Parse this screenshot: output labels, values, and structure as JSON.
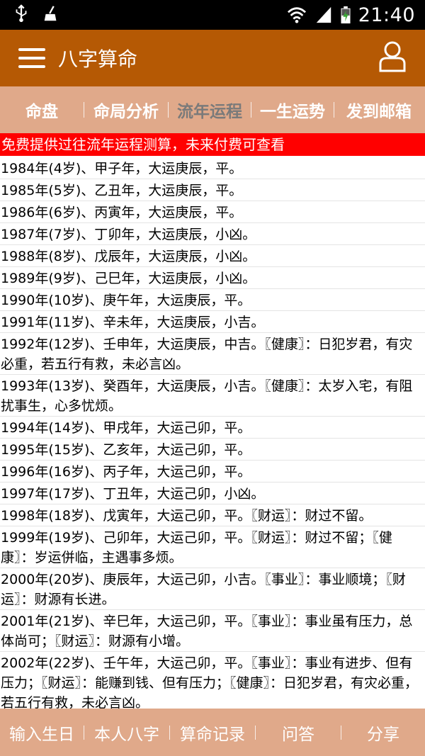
{
  "status_bar": {
    "time": "21:40",
    "icons": [
      "usb-icon",
      "cleaner-icon",
      "wifi-icon",
      "signal-icon",
      "battery-charging-icon"
    ]
  },
  "app_bar": {
    "title": "八字算命",
    "menu_icon": "hamburger-menu-icon",
    "user_icon": "user-profile-icon"
  },
  "tabs": [
    {
      "label": "命盘"
    },
    {
      "label": "命局分析"
    },
    {
      "label": "流年运程"
    },
    {
      "label": "一生运势"
    },
    {
      "label": "发到邮箱"
    }
  ],
  "active_tab": "流年运程",
  "notice": "免费提供过往流年运程测算，未来付费可查看",
  "entries": [
    "1984年(4岁)、甲子年，大运庚辰，平。",
    "1985年(5岁)、乙丑年，大运庚辰，平。",
    "1986年(6岁)、丙寅年，大运庚辰，平。",
    "1987年(7岁)、丁卯年，大运庚辰，小凶。",
    "1988年(8岁)、戊辰年，大运庚辰，小凶。",
    "1989年(9岁)、己巳年，大运庚辰，小凶。",
    "1990年(10岁)、庚午年，大运庚辰，平。",
    "1991年(11岁)、辛未年，大运庚辰，小吉。",
    "1992年(12岁)、壬申年，大运庚辰，中吉。〖健康〗：日犯岁君，有灾必重，若五行有救，未必言凶。",
    "1993年(13岁)、癸酉年，大运庚辰，小吉。〖健康〗：太岁入宅，有阻扰事生，心多忧烦。",
    "1994年(14岁)、甲戌年，大运己卯，平。",
    "1995年(15岁)、乙亥年，大运己卯，平。",
    "1996年(16岁)、丙子年，大运己卯，平。",
    "1997年(17岁)、丁丑年，大运己卯，小凶。",
    "1998年(18岁)、戊寅年，大运己卯，平。〖财运〗：财过不留。",
    "1999年(19岁)、己卯年，大运己卯，平。〖财运〗：财过不留；〖健康〗：岁运併临，主遇事多烦。",
    "2000年(20岁)、庚辰年，大运己卯，小吉。〖事业〗：事业顺境；〖财运〗：财源有长进。",
    "2001年(21岁)、辛巳年，大运己卯，平。〖事业〗：事业虽有压力，总体尚可；〖财运〗：财源有小增。",
    "2002年(22岁)、壬午年，大运己卯，平。〖事业〗：事业有进步、但有压力；〖财运〗：能赚到钱、但有压力；〖健康〗：日犯岁君，有灾必重，若五行有救，未必言凶。"
  ],
  "bottom_bar": [
    {
      "label": "输入生日"
    },
    {
      "label": "本人八字"
    },
    {
      "label": "算命记录"
    },
    {
      "label": "问答"
    },
    {
      "label": "分享"
    }
  ]
}
